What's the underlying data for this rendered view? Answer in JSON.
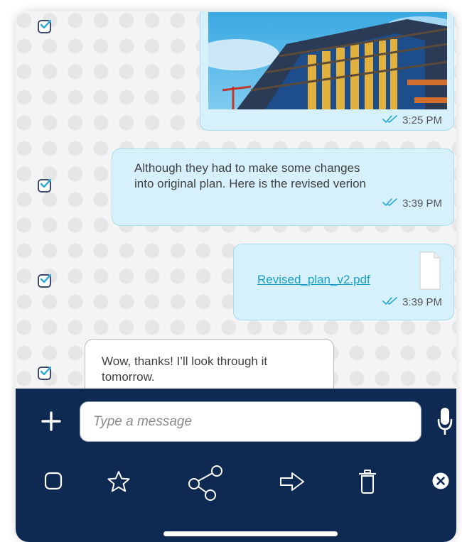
{
  "messages": [
    {
      "type": "image",
      "direction": "outgoing",
      "image_desc": "building-under-construction-photo",
      "time": "3:25 PM",
      "status": "read"
    },
    {
      "type": "text",
      "direction": "outgoing",
      "text_line1": "Although they had to make some changes",
      "text_line2": "into original plan. Here is the revised verion",
      "time": "3:39 PM",
      "status": "read"
    },
    {
      "type": "file",
      "direction": "outgoing",
      "file_name": "Revised_plan_v2.pdf",
      "time": "3:39 PM",
      "status": "read"
    },
    {
      "type": "text",
      "direction": "incoming",
      "text_line1": "Wow, thanks! I’ll look through it",
      "text_line2": "tomorrow."
    }
  ],
  "composer": {
    "placeholder": "Type a message",
    "left_icon": "plus-icon",
    "right_icon": "microphone-icon"
  },
  "selection_actions": [
    {
      "name": "select-all",
      "icon": "square-checkbox-icon"
    },
    {
      "name": "star",
      "icon": "star-icon"
    },
    {
      "name": "share",
      "icon": "share-icon"
    },
    {
      "name": "forward",
      "icon": "forward-arrow-icon"
    },
    {
      "name": "delete",
      "icon": "trash-icon"
    },
    {
      "name": "close",
      "icon": "close-circle-icon"
    }
  ],
  "colors": {
    "outgoing_bubble": "#d6f1fb",
    "incoming_bubble": "#ffffff",
    "bar_background": "#0f2a52",
    "read_ticks": "#2aa8d8",
    "link": "#1a9ec9"
  }
}
